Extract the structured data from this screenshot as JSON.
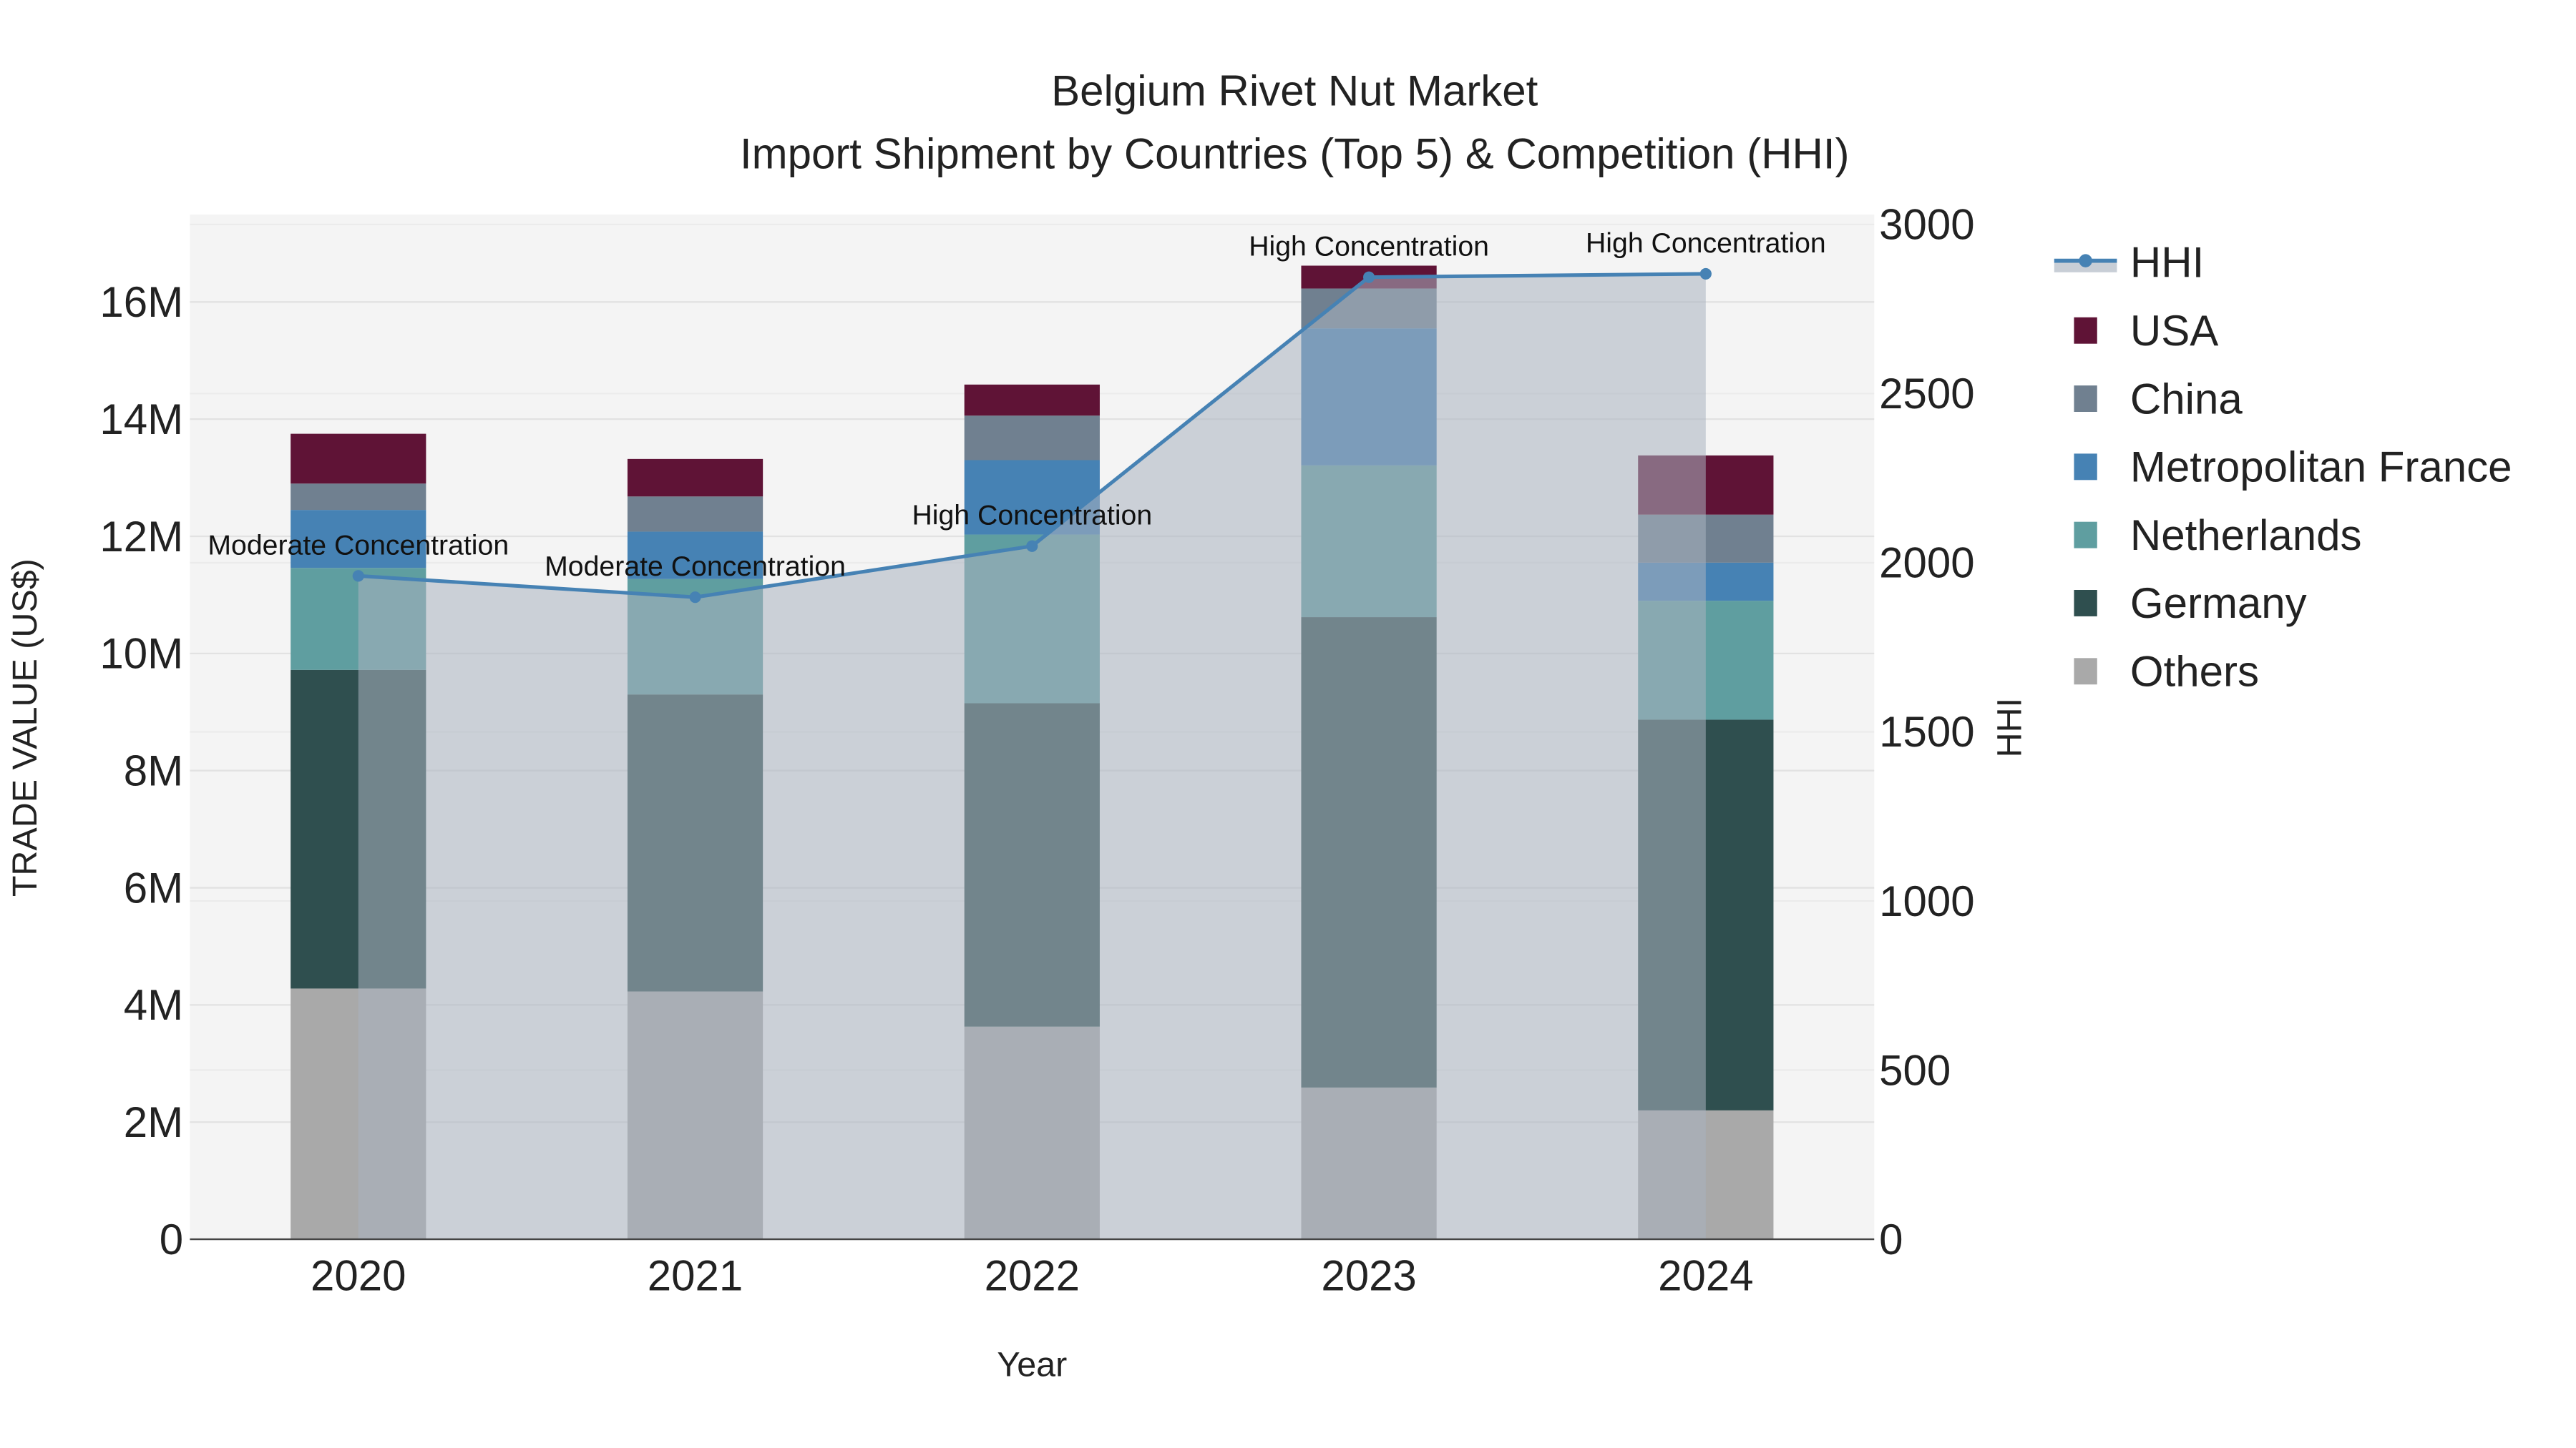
{
  "chart_data": {
    "type": "bar",
    "title_line1": "Belgium Rivet Nut Market",
    "title_line2": "Import Shipment by Countries (Top 5) & Competition (HHI)",
    "xlabel": "Year",
    "ylabel": "TRADE VALUE (US$)",
    "y2label": "HHI",
    "categories": [
      "2020",
      "2021",
      "2022",
      "2023",
      "2024"
    ],
    "ylim": [
      0,
      17400000
    ],
    "y_ticks": [
      0,
      2000000,
      4000000,
      6000000,
      8000000,
      10000000,
      12000000,
      14000000,
      16000000
    ],
    "y_tick_labels": [
      "0",
      "2M",
      "4M",
      "6M",
      "8M",
      "10M",
      "12M",
      "14M",
      "16M"
    ],
    "y2lim": [
      0,
      3000
    ],
    "y2_ticks": [
      0,
      500,
      1000,
      1500,
      2000,
      2500,
      3000
    ],
    "y2_tick_labels": [
      "0",
      "500",
      "1000",
      "1500",
      "2000",
      "2500",
      "3000"
    ],
    "stacked_series": [
      {
        "name": "Others",
        "color": "#a9a9a9",
        "values": [
          4280000,
          4230000,
          3630000,
          2590000,
          2200000
        ]
      },
      {
        "name": "Germany",
        "color": "#2f4f4f",
        "values": [
          5440000,
          5070000,
          5520000,
          8030000,
          6670000
        ]
      },
      {
        "name": "Netherlands",
        "color": "#5f9ea0",
        "values": [
          1740000,
          1970000,
          2880000,
          2590000,
          2030000
        ]
      },
      {
        "name": "Metropolitan France",
        "color": "#4682b4",
        "values": [
          990000,
          810000,
          1270000,
          2340000,
          650000
        ]
      },
      {
        "name": "China",
        "color": "#708090",
        "values": [
          450000,
          600000,
          760000,
          680000,
          820000
        ]
      },
      {
        "name": "USA",
        "color": "#5f1336",
        "values": [
          850000,
          640000,
          530000,
          390000,
          1010000
        ]
      }
    ],
    "line_series": {
      "name": "HHI",
      "color": "#4682b4",
      "values": [
        1961,
        1898,
        2049,
        2844,
        2854
      ],
      "annotations": [
        "Moderate Concentration",
        "Moderate Concentration",
        "High Concentration",
        "High Concentration",
        "High Concentration"
      ]
    },
    "legend": [
      "HHI",
      "USA",
      "China",
      "Metropolitan France",
      "Netherlands",
      "Germany",
      "Others"
    ],
    "legend_placement": "right",
    "grid": true
  }
}
